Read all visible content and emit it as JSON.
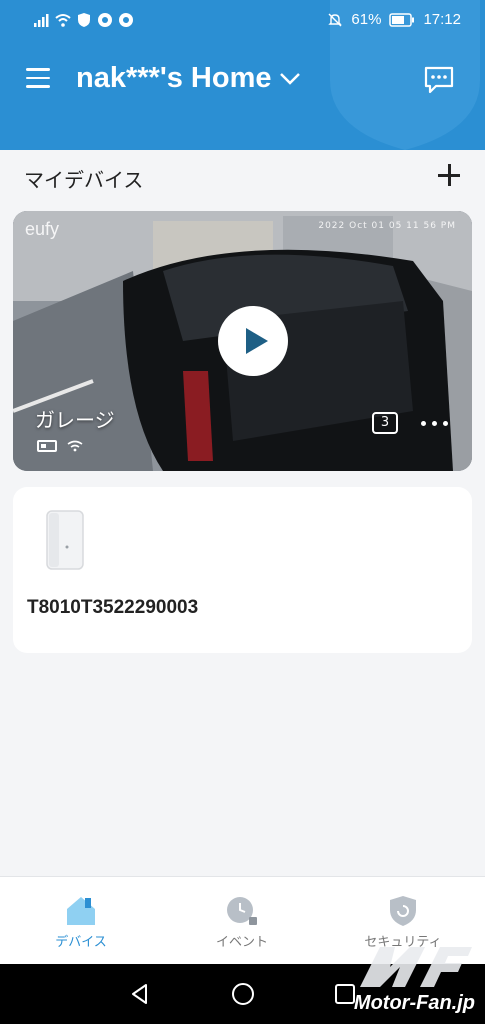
{
  "status": {
    "battery": "61%",
    "time": "17:12"
  },
  "header": {
    "home_title": "nak***'s Home"
  },
  "section": {
    "title": "マイデバイス"
  },
  "camera": {
    "name": "ガレージ",
    "clip_count": "3",
    "brand": "eufy",
    "timestamp": "2022 Oct 01 05 11 56 PM"
  },
  "station": {
    "name": "T8010T3522290003"
  },
  "nav": {
    "items": [
      {
        "label": "デバイス",
        "icon": "house-icon",
        "active": true
      },
      {
        "label": "イベント",
        "icon": "clock-icon",
        "active": false
      },
      {
        "label": "セキュリティ",
        "icon": "shield-icon",
        "active": false
      }
    ]
  },
  "watermark": "Motor-Fan.jp",
  "colors": {
    "header": "#2b8fd3",
    "accent": "#2b8fd3",
    "play": "#1e5f85"
  }
}
